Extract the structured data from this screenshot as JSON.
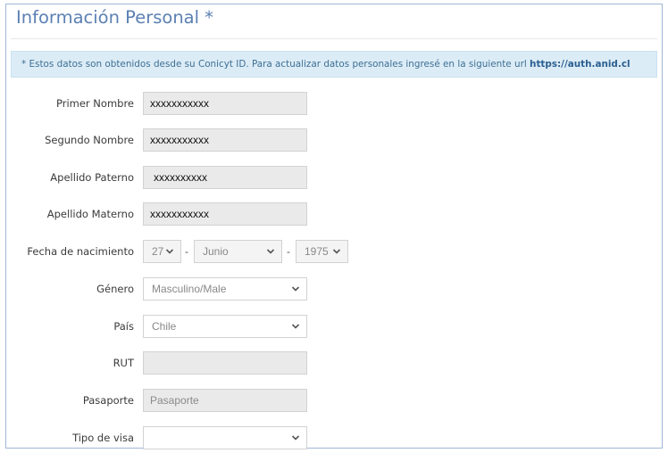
{
  "section": {
    "title": "Información Personal *"
  },
  "info_banner": {
    "text": "* Estos datos son obtenidos desde su Conicyt ID. Para actualizar datos personales ingresé en la siguiente url ",
    "link": "https://auth.anid.cl"
  },
  "form": {
    "primer_nombre": {
      "label": "Primer Nombre",
      "value": "xxxxxxxxxxx"
    },
    "segundo_nombre": {
      "label": "Segundo Nombre",
      "value": "xxxxxxxxxxx"
    },
    "apellido_paterno": {
      "label": "Apellido Paterno",
      "value": "xxxxxxxxxx"
    },
    "apellido_materno": {
      "label": "Apellido Materno",
      "value": "xxxxxxxxxxx"
    },
    "fecha_nacimiento": {
      "label": "Fecha de nacimiento",
      "day": "27",
      "month": "Junio",
      "year": "1975",
      "separator": "-"
    },
    "genero": {
      "label": "Género",
      "value": "Masculino/Male"
    },
    "pais": {
      "label": "País",
      "value": "Chile"
    },
    "rut": {
      "label": "RUT",
      "value": ""
    },
    "pasaporte": {
      "label": "Pasaporte",
      "placeholder": "Pasaporte"
    },
    "tipo_visa": {
      "label": "Tipo de visa",
      "value": ""
    }
  },
  "icons": {
    "select_arrow": "chevron-down-icon"
  },
  "colors": {
    "title": "#5b80b3",
    "banner_bg": "#dcecf6",
    "link": "#2a5f90",
    "panel_border": "#9fb7d6"
  }
}
